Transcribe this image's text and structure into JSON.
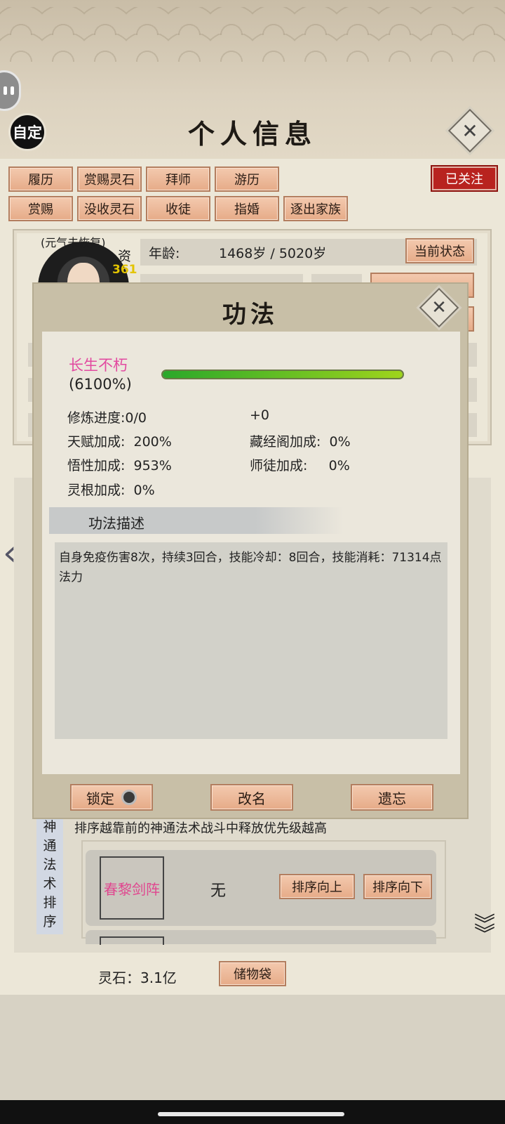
{
  "header": {
    "auto_label": "自定",
    "title": "个人信息"
  },
  "follow_badge": "已关注",
  "tabs_row1": [
    "履历",
    "赏赐灵石",
    "拜师",
    "游历"
  ],
  "tabs_row2": [
    "赏赐",
    "没收灵石",
    "收徒",
    "指婚",
    "逐出家族"
  ],
  "profile": {
    "health_note": "(元气未恢复)",
    "aptitude_label": "资",
    "aptitude_value": "361",
    "age_label": "年龄:",
    "age_value": "1468岁 / 5020岁",
    "status_button": "当前状态"
  },
  "dialog": {
    "title": "功法",
    "technique_name": "长生不朽",
    "technique_level": "(6100%)",
    "progress": 1.0,
    "stats": {
      "cultivation": "修炼进度:0/0",
      "cultivation_bonus": "+0",
      "talent_bonus": "天赋加成:  200%",
      "library_bonus": "藏经阁加成:  0%",
      "comprehension_bonus": "悟性加成:  953%",
      "master_bonus": "师徒加成:     0%",
      "root_bonus": "灵根加成:  0%"
    },
    "desc_title": "功法描述",
    "description": "自身免疫伤害8次，持续3回合，技能冷却：8回合，技能消耗：71314点法力",
    "buttons": {
      "lock": "锁定",
      "rename": "改名",
      "forget": "遗忘"
    }
  },
  "skills": {
    "vertical_label": [
      "神",
      "通",
      "法",
      "术",
      "排",
      "序"
    ],
    "note": "排序越靠前的神通法术战斗中释放优先级越高",
    "items": [
      {
        "name": "春黎剑阵",
        "slot": "无",
        "up": "排序向上",
        "down": "排序向下"
      }
    ]
  },
  "footer": {
    "spirit_stone": "灵石：3.1亿",
    "bag_button": "储物袋"
  },
  "colors": {
    "accent_pink": "#e24aa0",
    "seal_red": "#b8231f",
    "button_peach": "#eeb796"
  }
}
